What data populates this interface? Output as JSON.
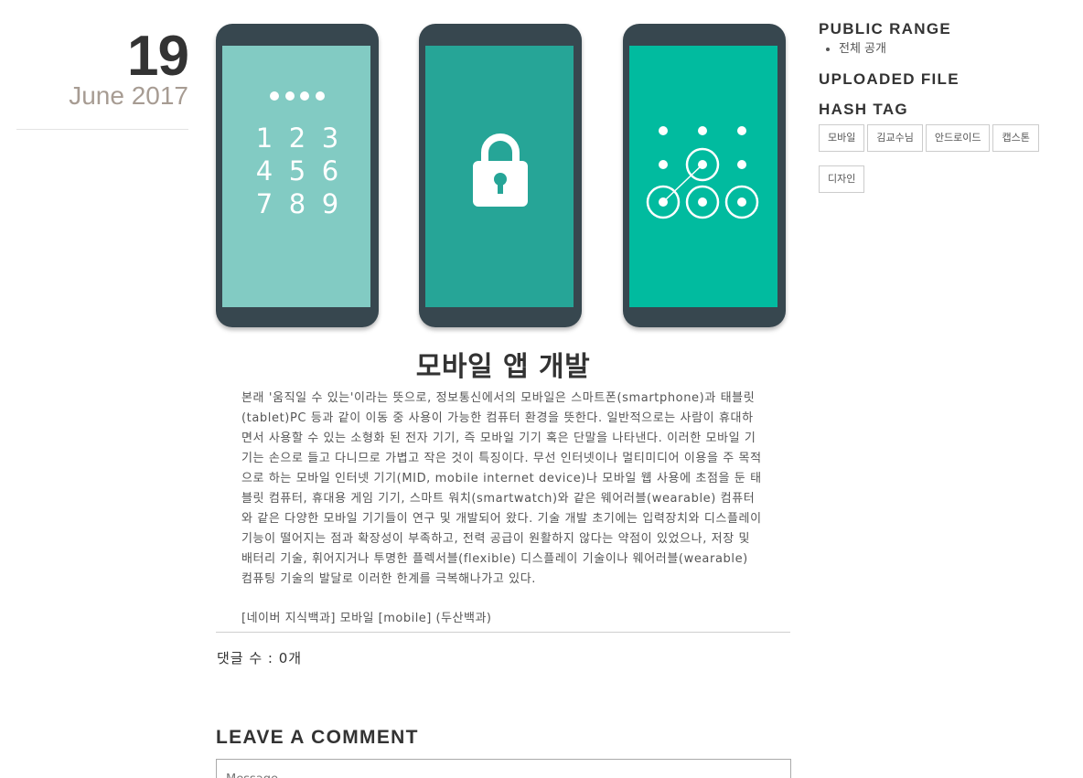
{
  "date": {
    "day": "19",
    "month_year": "June 2017"
  },
  "hero": {
    "keypad": [
      "1",
      "2",
      "3",
      "4",
      "5",
      "6",
      "7",
      "8",
      "9"
    ],
    "colors": {
      "body": "#37474f",
      "screen1": "#82cbc3",
      "screen2": "#26a597",
      "screen3": "#01bb9f"
    }
  },
  "post": {
    "title": "모바일 앱 개발",
    "body": "본래 '움직일 수 있는'이라는 뜻으로, 정보통신에서의 모바일은 스마트폰(smartphone)과 태블릿(tablet)PC 등과 같이 이동 중 사용이 가능한 컴퓨터 환경을 뜻한다. 일반적으로는 사람이 휴대하면서 사용할 수 있는 소형화 된 전자 기기, 즉 모바일 기기 혹은 단말을 나타낸다. 이러한 모바일 기기는 손으로 들고 다니므로 가볍고 작은 것이 특징이다. 무선 인터넷이나 멀티미디어 이용을 주 목적으로 하는 모바일 인터넷 기기(MID, mobile internet device)나 모바일 웹 사용에 초점을 둔 태블릿 컴퓨터, 휴대용 게임 기기, 스마트 워치(smartwatch)와 같은 웨어러블(wearable) 컴퓨터와 같은 다양한 모바일 기기들이 연구 및 개발되어 왔다. 기술 개발 초기에는 입력장치와 디스플레이 기능이 떨어지는 점과 확장성이 부족하고, 전력 공급이 원활하지 않다는 약점이 있었으나, 저장 및 배터리 기술, 휘어지거나 투명한 플렉서블(flexible) 디스플레이 기술이나 웨어러블(wearable) 컴퓨팅 기술의 발달로 이러한 한계를 극복해나가고 있다.",
    "source": "[네이버 지식백과] 모바일 [mobile] (두산백과)",
    "comment_count": "댓글 수 : 0개"
  },
  "comment": {
    "title": "LEAVE A COMMENT",
    "message_placeholder": "Message"
  },
  "sidebar": {
    "public_range": {
      "heading": "PUBLIC RANGE",
      "items": [
        "전체 공개"
      ]
    },
    "uploaded_file": {
      "heading": "UPLOADED FILE"
    },
    "hash_tag": {
      "heading": "HASH TAG",
      "tags": [
        "모바일",
        "김교수님",
        "안드로이드",
        "캡스톤",
        "디자인"
      ]
    }
  }
}
